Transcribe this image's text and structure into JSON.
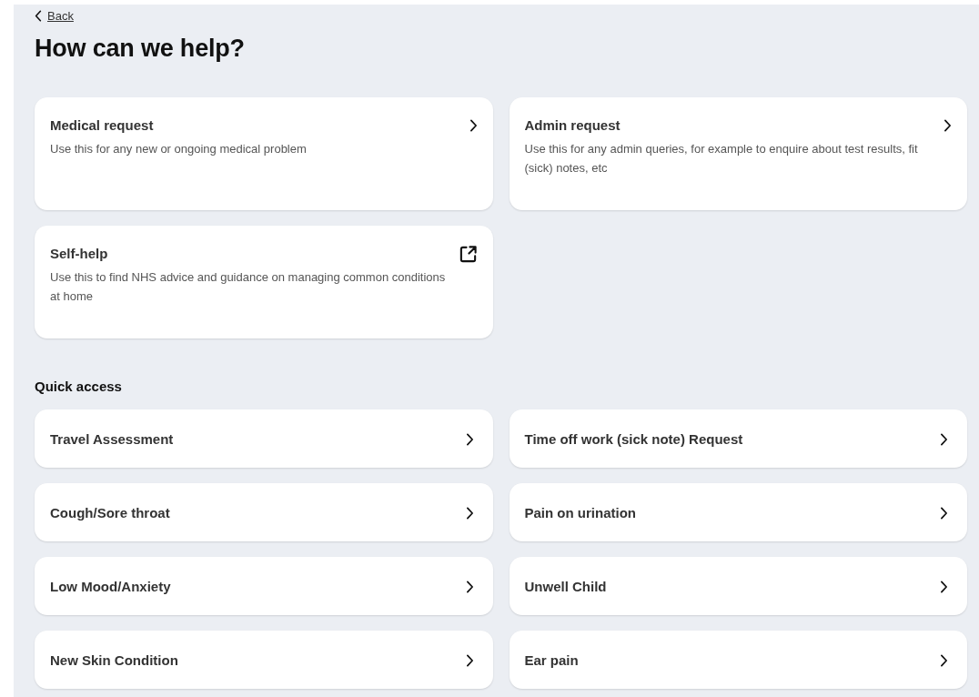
{
  "back_link": {
    "label": "Back"
  },
  "heading": "How can we help?",
  "options": [
    {
      "kind": "internal",
      "title": "Medical request",
      "description": "Use this for any new or ongoing medical problem"
    },
    {
      "kind": "internal",
      "title": "Admin request",
      "description": "Use this for any admin queries, for example to enquire about test results, fit (sick) notes, etc"
    },
    {
      "kind": "external",
      "title": "Self-help",
      "description": "Use this to find NHS advice and guidance on managing common conditions at home"
    }
  ],
  "quick_access": {
    "title": "Quick access",
    "items": [
      "Travel Assessment",
      "Time off work (sick note) Request",
      "Cough/Sore throat",
      "Pain on urination",
      "Low Mood/Anxiety",
      "Unwell Child",
      "New Skin Condition",
      "Ear pain"
    ]
  }
}
